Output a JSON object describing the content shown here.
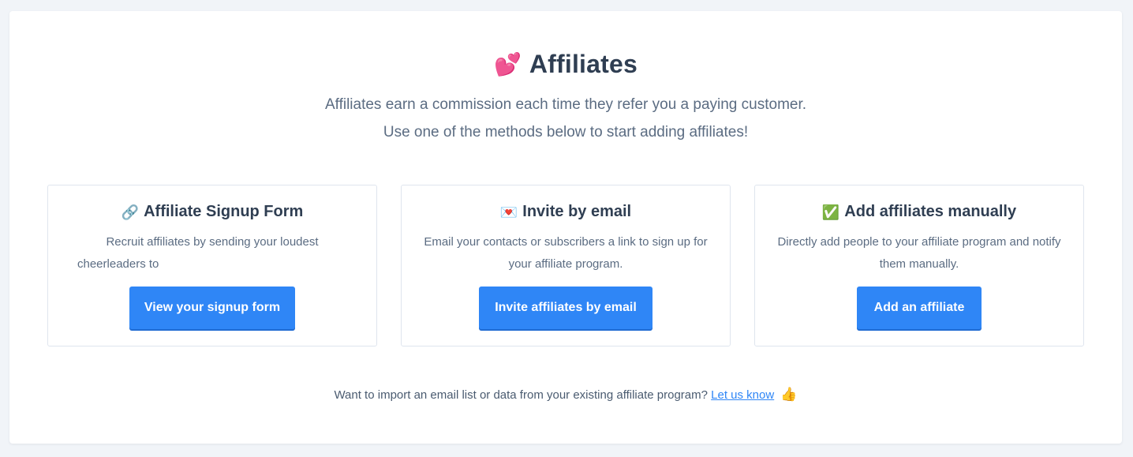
{
  "header": {
    "title_emoji": "💕",
    "title": "Affiliates",
    "subtitle_line1": "Affiliates earn a commission each time they refer you a paying customer.",
    "subtitle_line2": "Use one of the methods below to start adding affiliates!"
  },
  "cards": [
    {
      "icon": "🔗",
      "icon_name": "link-icon",
      "title": "Affiliate Signup Form",
      "desc_line1": "Recruit affiliates by sending your loudest",
      "desc_line2": "cheerleaders to",
      "button": "View your signup form"
    },
    {
      "icon": "💌",
      "icon_name": "love-letter-icon",
      "title": "Invite by email",
      "desc": "Email your contacts or subscribers a link to sign up for your affiliate program.",
      "button": "Invite affiliates by email"
    },
    {
      "icon": "✅",
      "icon_name": "check-mark-icon",
      "title": "Add affiliates manually",
      "desc": "Directly add people to your affiliate program and notify them manually.",
      "button": "Add an affiliate"
    }
  ],
  "footer": {
    "text": "Want to import an email list or data from your existing affiliate program?",
    "link": "Let us know",
    "icon": "👍"
  },
  "colors": {
    "accent": "#2f86f6",
    "text_dark": "#2f3e52",
    "text_muted": "#5b6c82",
    "page_bg": "#f1f4f8"
  }
}
